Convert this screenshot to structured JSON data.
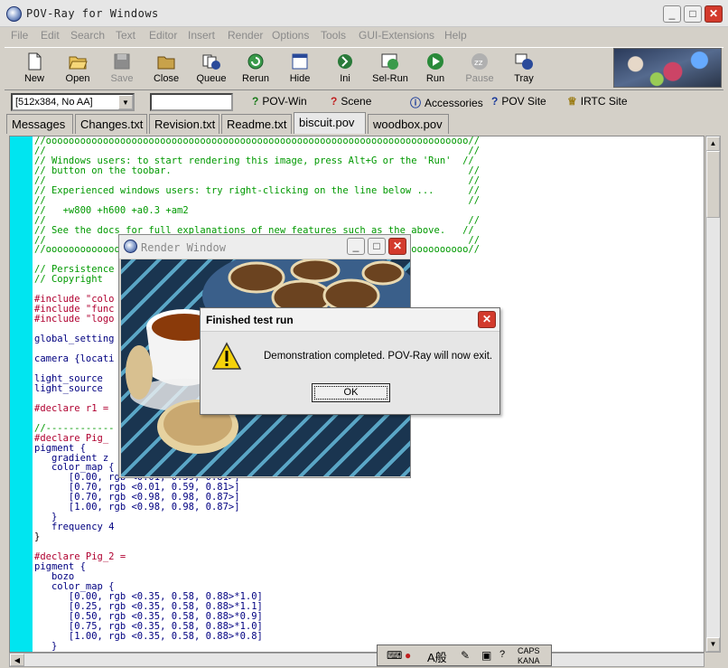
{
  "app": {
    "title": "POV-Ray for Windows"
  },
  "menu": [
    "File",
    "Edit",
    "Search",
    "Text",
    "Editor",
    "Insert",
    "Render",
    "Options",
    "Tools",
    "GUI-Extensions",
    "Help"
  ],
  "toolbar": [
    {
      "label": "New",
      "icon": "new-document-icon",
      "enabled": true
    },
    {
      "label": "Open",
      "icon": "open-folder-icon",
      "enabled": true
    },
    {
      "label": "Save",
      "icon": "save-disk-icon",
      "enabled": false
    },
    {
      "label": "Close",
      "icon": "close-folder-icon",
      "enabled": true
    },
    {
      "label": "Queue",
      "icon": "queue-icon",
      "enabled": true
    },
    {
      "label": "Rerun",
      "icon": "rerun-icon",
      "enabled": true
    },
    {
      "label": "Hide",
      "icon": "hide-window-icon",
      "enabled": true
    },
    {
      "label": "Ini",
      "icon": "ini-icon",
      "enabled": true
    },
    {
      "label": "Sel-Run",
      "icon": "sel-run-icon",
      "enabled": true
    },
    {
      "label": "Run",
      "icon": "run-icon",
      "enabled": true
    },
    {
      "label": "Pause",
      "icon": "pause-icon",
      "enabled": false
    },
    {
      "label": "Tray",
      "icon": "tray-icon",
      "enabled": true
    }
  ],
  "resolution_combo": "[512x384, No AA]",
  "links": [
    {
      "label": "POV-Win",
      "icon": "help-icon"
    },
    {
      "label": "Scene",
      "icon": "help-icon"
    },
    {
      "label": "Accessories",
      "icon": "info-icon"
    },
    {
      "label": "POV Site",
      "icon": "help-icon"
    },
    {
      "label": "IRTC Site",
      "icon": "trophy-icon"
    }
  ],
  "tabs": [
    "Messages",
    "Changes.txt",
    "Revision.txt",
    "Readme.txt",
    "biscuit.pov",
    "woodbox.pov"
  ],
  "active_tab": "biscuit.pov",
  "code": {
    "l1": "//oooooooooooooooooooooooooooooooooooooooooooooooooooooooooooooooooooooooooo//",
    "l2": "//                                                                          //",
    "l3": "// Windows users: to start rendering this image, press Alt+G or the 'Run'  //",
    "l4": "// button on the toobar.                                                    //",
    "l5": "//                                                                          //",
    "l6": "// Experienced windows users: try right-clicking on the line below ...      //",
    "l7": "//                                                                          //",
    "l8": "//   +w800 +h600 +a0.3 +am2",
    "l9": "//                                                                          //",
    "l10": "// See the docs for full explanations of new features such as the above.   //",
    "l11": "//                                                                          //",
    "l12": "//oooooooooooooooooooooooooooooooooooooooooooooooooooooooooooooooooooooooooo//",
    "l13": "",
    "l14": "// Persistence",
    "l15": "// Copyright",
    "l16": "",
    "l17": "#include \"colo",
    "l18": "#include \"func",
    "l19": "#include \"logo",
    "l20": "",
    "l21": "global_setting",
    "l22": "",
    "l23": "camera {locati",
    "l24": "",
    "l25": "light_source",
    "l26": "light_source",
    "l27": "",
    "l28": "#declare r1 =",
    "l29": "",
    "l30": "//------------",
    "l31": "#declare Pig_",
    "l32": "pigment {",
    "l33": "   gradient z",
    "l34": "   color_map {",
    "l35": "      [0.00, rgb <0.01, 0.59, 0.81>]",
    "l36": "      [0.70, rgb <0.01, 0.59, 0.81>]",
    "l37": "      [0.70, rgb <0.98, 0.98, 0.87>]",
    "l38": "      [1.00, rgb <0.98, 0.98, 0.87>]",
    "l39": "   }",
    "l40": "   frequency 4",
    "l41": "}",
    "l42": "",
    "l43": "#declare Pig_2 =",
    "l44": "pigment {",
    "l45": "   bozo",
    "l46": "   color_map {",
    "l47": "      [0.00, rgb <0.35, 0.58, 0.88>*1.0]",
    "l48": "      [0.25, rgb <0.35, 0.58, 0.88>*1.1]",
    "l49": "      [0.50, rgb <0.35, 0.58, 0.88>*0.9]",
    "l50": "      [0.75, rgb <0.35, 0.58, 0.88>*1.0]",
    "l51": "      [1.00, rgb <0.35, 0.58, 0.88>*0.8]",
    "l52": "   }"
  },
  "render_window": {
    "title": "Render Window"
  },
  "dialog": {
    "title": "Finished test run",
    "message": "Demonstration completed. POV-Ray will now exit.",
    "ok": "OK"
  },
  "ime": {
    "mode": "A般",
    "caps": "CAPS",
    "kana": "KANA"
  }
}
